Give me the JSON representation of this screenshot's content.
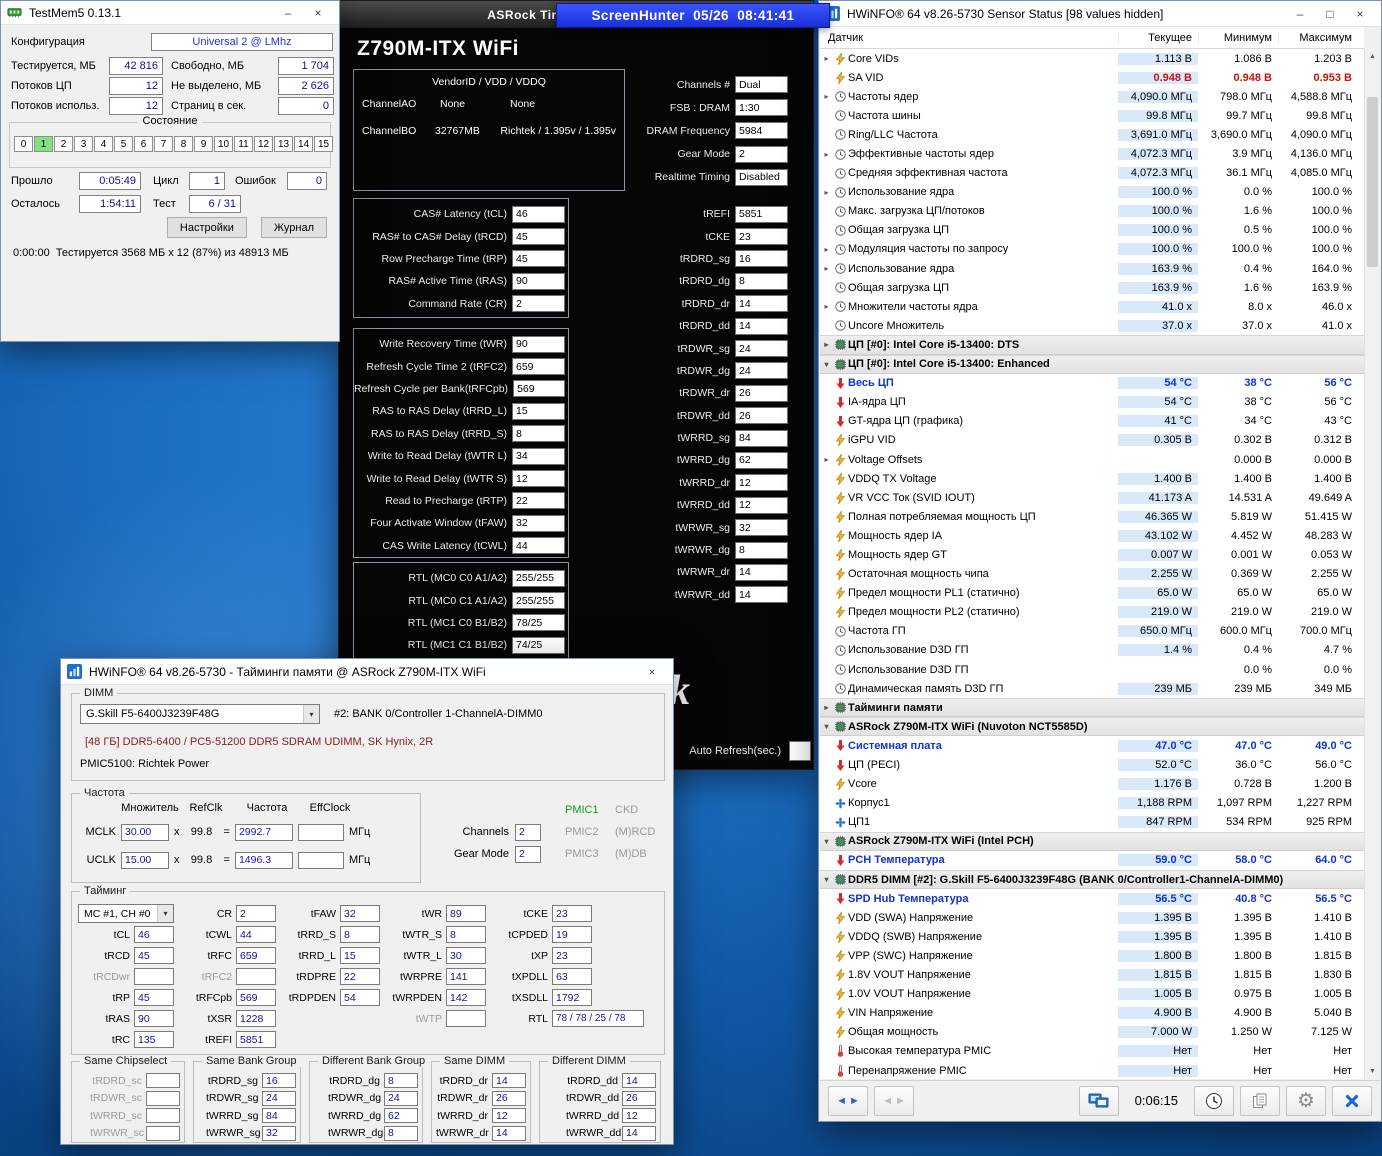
{
  "screenhunter": {
    "title": "ScreenHunter  05/26  08:41:41"
  },
  "testmem5": {
    "title": "TestMem5  0.13.1",
    "config_label": "Конфигурация",
    "config_value": "Universal 2 @ LMhz",
    "stats": [
      {
        "l1": "Тестируется, МБ",
        "v1": "42 816",
        "l2": "Свободно, МБ",
        "v2": "1 704"
      },
      {
        "l1": "Потоков ЦП",
        "v1": "12",
        "l2": "Не выделено, МБ",
        "v2": "2 626"
      },
      {
        "l1": "Потоков использ.",
        "v1": "12",
        "l2": "Страниц в сек.",
        "v2": "0"
      }
    ],
    "state_title": "Состояние",
    "cells": [
      "0",
      "1",
      "2",
      "3",
      "4",
      "5",
      "6",
      "7",
      "8",
      "9",
      "10",
      "11",
      "12",
      "13",
      "14",
      "15"
    ],
    "active_cell_index": 1,
    "progress": {
      "elapsed_label": "Прошло",
      "elapsed": "0:05:49",
      "cycle_label": "Цикл",
      "cycle": "1",
      "errors_label": "Ошибок",
      "errors": "0",
      "remaining_label": "Осталось",
      "remaining": "1:54:11",
      "test_label": "Тест",
      "test": "6 / 31"
    },
    "buttons": {
      "settings": "Настройки",
      "journal": "Журнал"
    },
    "log": "0:00:00  Тестируется 3568 МБ x 12 (87%) из 48913 МБ"
  },
  "asrock": {
    "window_title": "ASRock Timing Configurator",
    "board": "Z790M-ITX WiFi",
    "info": {
      "header": "VendorID / VDD / VDDQ",
      "rows": [
        {
          "channel": "ChannelAO",
          "c1": "None",
          "c2": "None"
        },
        {
          "channel": "ChannelBO",
          "c1": "32767MB",
          "c2": "Richtek / 1.395v / 1.395v"
        }
      ]
    },
    "config_fields": [
      {
        "label": "Channels #",
        "value": "Dual"
      },
      {
        "label": "FSB : DRAM",
        "value": "1:30"
      },
      {
        "label": "DRAM Frequency",
        "value": "5984"
      },
      {
        "label": "Gear Mode",
        "value": "2"
      },
      {
        "label": "Realtime Timing",
        "value": "Disabled"
      }
    ],
    "primary_timings": [
      {
        "label": "CAS# Latency (tCL)",
        "value": "46"
      },
      {
        "label": "RAS# to CAS# Delay (tRCD)",
        "value": "45"
      },
      {
        "label": "Row Precharge Time (tRP)",
        "value": "45"
      },
      {
        "label": "RAS# Active Time (tRAS)",
        "value": "90"
      },
      {
        "label": "Command Rate (CR)",
        "value": "2"
      }
    ],
    "secondary_timings": [
      {
        "label": "Write Recovery Time (tWR)",
        "value": "90"
      },
      {
        "label": "Refresh Cycle Time 2 (tRFC2)",
        "value": "659"
      },
      {
        "label": "Refresh Cycle per Bank(tRFCpb)",
        "value": "569"
      },
      {
        "label": "RAS to RAS Delay (tRRD_L)",
        "value": "15"
      },
      {
        "label": "RAS to RAS Delay (tRRD_S)",
        "value": "8"
      },
      {
        "label": "Write to Read Delay (tWTR  L)",
        "value": "34"
      },
      {
        "label": "Write to Read Delay (tWTR  S)",
        "value": "12"
      },
      {
        "label": "Read to Precharge (tRTP)",
        "value": "22"
      },
      {
        "label": "Four Activate Window (tFAW)",
        "value": "32"
      },
      {
        "label": "CAS Write Latency (tCWL)",
        "value": "44"
      }
    ],
    "rtl": [
      {
        "label": "RTL (MC0 C0 A1/A2)",
        "value": "255/255"
      },
      {
        "label": "RTL (MC0 C1 A1/A2)",
        "value": "255/255"
      },
      {
        "label": "RTL (MC1 C0 B1/B2)",
        "value": "78/25"
      },
      {
        "label": "RTL (MC1 C1 B1/B2)",
        "value": "74/25"
      }
    ],
    "right_timings": [
      {
        "label": "tREFI",
        "value": "5851"
      },
      {
        "label": "tCKE",
        "value": "23"
      },
      {
        "label": "tRDRD_sg",
        "value": "16"
      },
      {
        "label": "tRDRD_dg",
        "value": "8"
      },
      {
        "label": "tRDRD_dr",
        "value": "14"
      },
      {
        "label": "tRDRD_dd",
        "value": "14"
      },
      {
        "label": "tRDWR_sg",
        "value": "24"
      },
      {
        "label": "tRDWR_dg",
        "value": "24"
      },
      {
        "label": "tRDWR_dr",
        "value": "26"
      },
      {
        "label": "tRDWR_dd",
        "value": "26"
      },
      {
        "label": "tWRRD_sg",
        "value": "84"
      },
      {
        "label": "tWRRD_dg",
        "value": "62"
      },
      {
        "label": "tWRRD_dr",
        "value": "12"
      },
      {
        "label": "tWRRD_dd",
        "value": "12"
      },
      {
        "label": "tWRWR_sg",
        "value": "32"
      },
      {
        "label": "tWRWR_dg",
        "value": "8"
      },
      {
        "label": "tWRWR_dr",
        "value": "14"
      },
      {
        "label": "tWRWR_dd",
        "value": "14"
      }
    ],
    "logo": "ASRock",
    "refresh_label": "Auto Refresh(sec.)"
  },
  "hwinfo_timings": {
    "title": "HWiNFO® 64 v8.26-5730 - Тайминги памяти @ ASRock Z790M-ITX WiFi",
    "dimm": {
      "group_label": "DIMM",
      "dropdown": "G.Skill F5-6400J3239F48G",
      "slot": "#2: BANK 0/Controller 1-ChannelA-DIMM0",
      "module": "[48 ГБ] DDR5-6400 / PC5-51200 DDR5 SDRAM UDIMM, SK Hynix, 2R",
      "pmic": "PMIC5100: Richtek Power"
    },
    "freq": {
      "group_label": "Частота",
      "headers": [
        "Множитель",
        "RefClk",
        "Частота",
        "EffClock"
      ],
      "rows": [
        {
          "name": "MCLK",
          "mult": "30.00",
          "refclk": "99.8",
          "freq": "2992.7",
          "unit": "МГц"
        },
        {
          "name": "UCLK",
          "mult": "15.00",
          "refclk": "99.8",
          "freq": "1496.3",
          "unit": "МГц"
        }
      ],
      "channels_label": "Channels",
      "channels": "2",
      "gearmode_label": "Gear Mode",
      "gearmode": "2",
      "pmics": [
        {
          "name": "PMIC1",
          "value": "CKD"
        },
        {
          "name": "PMIC2",
          "value": "(M)RCD"
        },
        {
          "name": "PMIC3",
          "value": "(M)DB"
        }
      ]
    },
    "timing": {
      "group_label": "Тайминг",
      "mc_dropdown": "MC #1, CH #0",
      "grid": [
        [
          {
            "t": "dd"
          },
          {
            "l": "CR",
            "v": "2"
          },
          {
            "l": "tFAW",
            "v": "32"
          },
          {
            "l": "tWR",
            "v": "89"
          },
          {
            "l": "tCKE",
            "v": "23"
          }
        ],
        [
          {
            "l": "tCL",
            "v": "46"
          },
          {
            "l": "tCWL",
            "v": "44"
          },
          {
            "l": "tRRD_S",
            "v": "8"
          },
          {
            "l": "tWTR_S",
            "v": "8"
          },
          {
            "l": "tCPDED",
            "v": "19"
          }
        ],
        [
          {
            "l": "tRCD",
            "v": "45"
          },
          {
            "l": "tRFC",
            "v": "659"
          },
          {
            "l": "tRRD_L",
            "v": "15"
          },
          {
            "l": "tWTR_L",
            "v": "30"
          },
          {
            "l": "tXP",
            "v": "23"
          }
        ],
        [
          {
            "l": "tRCDwr",
            "v": "",
            "dim": true
          },
          {
            "l": "tRFC2",
            "v": "",
            "dim": true
          },
          {
            "l": "tRDPRE",
            "v": "22"
          },
          {
            "l": "tWRPRE",
            "v": "141"
          },
          {
            "l": "tXPDLL",
            "v": "63"
          }
        ],
        [
          {
            "l": "tRP",
            "v": "45"
          },
          {
            "l": "tRFCpb",
            "v": "569"
          },
          {
            "l": "tRDPDEN",
            "v": "54"
          },
          {
            "l": "tWRPDEN",
            "v": "142"
          },
          {
            "l": "tXSDLL",
            "v": "1792"
          }
        ],
        [
          {
            "l": "tRAS",
            "v": "90"
          },
          {
            "l": "tXSR",
            "v": "1228"
          },
          {},
          {
            "l": "tWTP",
            "v": "",
            "dim": true
          },
          {
            "l": "RTL",
            "v": "78 / 78 / 25 / 78",
            "wide": true
          }
        ],
        [
          {
            "l": "tRC",
            "v": "135"
          },
          {
            "l": "tREFI",
            "v": "5851"
          },
          {},
          {},
          {}
        ]
      ]
    },
    "banks": [
      {
        "title": "Same Chipselect",
        "rows": [
          {
            "l": "tRDRD_sc",
            "v": "",
            "dim": true
          },
          {
            "l": "tRDWR_sc",
            "v": "",
            "dim": true
          },
          {
            "l": "tWRRD_sc",
            "v": "",
            "dim": true
          },
          {
            "l": "tWRWR_sc",
            "v": "",
            "dim": true
          }
        ]
      },
      {
        "title": "Same Bank Group",
        "rows": [
          {
            "l": "tRDRD_sg",
            "v": "16"
          },
          {
            "l": "tRDWR_sg",
            "v": "24"
          },
          {
            "l": "tWRRD_sg",
            "v": "84"
          },
          {
            "l": "tWRWR_sg",
            "v": "32"
          }
        ]
      },
      {
        "title": "Different Bank Group",
        "rows": [
          {
            "l": "tRDRD_dg",
            "v": "8"
          },
          {
            "l": "tRDWR_dg",
            "v": "24"
          },
          {
            "l": "tWRRD_dg",
            "v": "62"
          },
          {
            "l": "tWRWR_dg",
            "v": "8"
          }
        ]
      },
      {
        "title": "Same DIMM",
        "rows": [
          {
            "l": "tRDRD_dr",
            "v": "14"
          },
          {
            "l": "tRDWR_dr",
            "v": "26"
          },
          {
            "l": "tWRRD_dr",
            "v": "12"
          },
          {
            "l": "tWRWR_dr",
            "v": "14"
          }
        ]
      },
      {
        "title": "Different DIMM",
        "rows": [
          {
            "l": "tRDRD_dd",
            "v": "14"
          },
          {
            "l": "tRDWR_dd",
            "v": "26"
          },
          {
            "l": "tWRRD_dd",
            "v": "12"
          },
          {
            "l": "tWRWR_dd",
            "v": "14"
          }
        ]
      }
    ]
  },
  "hwinfo_sensors": {
    "title": "HWiNFO® 64 v8.26-5730 Sensor Status [98 values hidden]",
    "columns": [
      "Датчик",
      "Текущее",
      "Минимум",
      "Максимум"
    ],
    "rows": [
      {
        "i": "bolt",
        "e": true,
        "n": "Core VIDs",
        "c": "1.113 В",
        "m": "1.086 В",
        "x": "1.203 В"
      },
      {
        "i": "bolt",
        "r": true,
        "n": "SA VID",
        "c": "0.948 В",
        "m": "0.948 В",
        "x": "0.953 В"
      },
      {
        "i": "clock",
        "e": true,
        "n": "Частоты ядер",
        "c": "4,090.0 МГц",
        "m": "798.0 МГц",
        "x": "4,588.8 МГц"
      },
      {
        "i": "clock",
        "n": "Частота шины",
        "c": "99.8 МГц",
        "m": "99.7 МГц",
        "x": "99.8 МГц"
      },
      {
        "i": "clock",
        "n": "Ring/LLC Частота",
        "c": "3,691.0 МГц",
        "m": "3,690.0 МГц",
        "x": "4,090.0 МГц"
      },
      {
        "i": "clock",
        "e": true,
        "n": "Эффективные частоты ядер",
        "c": "4,072.3 МГц",
        "m": "3.9 МГц",
        "x": "4,136.0 МГц"
      },
      {
        "i": "clock",
        "n": "Средняя эффективная частота",
        "c": "4,072.3 МГц",
        "m": "36.1 МГц",
        "x": "4,085.0 МГц"
      },
      {
        "i": "clock",
        "e": true,
        "n": "Использование ядра",
        "c": "100.0 %",
        "m": "0.0 %",
        "x": "100.0 %"
      },
      {
        "i": "clock",
        "n": "Макс. загрузка ЦП/потоков",
        "c": "100.0 %",
        "m": "1.6 %",
        "x": "100.0 %"
      },
      {
        "i": "clock",
        "n": "Общая загрузка ЦП",
        "c": "100.0 %",
        "m": "0.5 %",
        "x": "100.0 %"
      },
      {
        "i": "clock",
        "e": true,
        "n": "Модуляция частоты по запросу",
        "c": "100.0 %",
        "m": "100.0 %",
        "x": "100.0 %"
      },
      {
        "i": "clock",
        "e": true,
        "n": "Использование ядра",
        "c": "163.9 %",
        "m": "0.4 %",
        "x": "164.0 %"
      },
      {
        "i": "clock",
        "n": "Общая загрузка ЦП",
        "c": "163.9 %",
        "m": "1.6 %",
        "x": "163.9 %"
      },
      {
        "i": "clock",
        "e": true,
        "n": "Множители частоты ядра",
        "c": "41.0 x",
        "m": "8.0 x",
        "x": "46.0 x"
      },
      {
        "i": "clock",
        "n": "Uncore Множитель",
        "c": "37.0 x",
        "m": "37.0 x",
        "x": "41.0 x"
      },
      {
        "t": "s",
        "n": "ЦП [#0]: Intel Core i5-13400: DTS"
      },
      {
        "t": "s",
        "o": true,
        "n": "ЦП [#0]: Intel Core i5-13400: Enhanced"
      },
      {
        "i": "arrow",
        "a": true,
        "n": "Весь ЦП",
        "c": "54 °C",
        "m": "38 °C",
        "x": "56 °C"
      },
      {
        "i": "arrow",
        "n": "IA-ядра ЦП",
        "c": "54 °C",
        "m": "38 °C",
        "x": "56 °C"
      },
      {
        "i": "arrow",
        "n": "GT-ядра ЦП (графика)",
        "c": "41 °C",
        "m": "34 °C",
        "x": "43 °C"
      },
      {
        "i": "bolt",
        "n": "iGPU VID",
        "c": "0.305 В",
        "m": "0.302 В",
        "x": "0.312 В"
      },
      {
        "i": "bolt",
        "e": true,
        "n": "Voltage Offsets",
        "c": "",
        "m": "0.000 В",
        "x": "0.000 В"
      },
      {
        "i": "bolt",
        "n": "VDDQ TX Voltage",
        "c": "1.400 В",
        "m": "1.400 В",
        "x": "1.400 В"
      },
      {
        "i": "bolt",
        "n": "VR VCC Ток (SVID IOUT)",
        "c": "41.173 A",
        "m": "14.531 A",
        "x": "49.649 A"
      },
      {
        "i": "bolt",
        "n": "Полная потребляемая мощность ЦП",
        "c": "46.365 W",
        "m": "5.819 W",
        "x": "51.415 W"
      },
      {
        "i": "bolt",
        "n": "Мощность ядер IA",
        "c": "43.102 W",
        "m": "4.452 W",
        "x": "48.283 W"
      },
      {
        "i": "bolt",
        "n": "Мощность ядер GT",
        "c": "0.007 W",
        "m": "0.001 W",
        "x": "0.053 W"
      },
      {
        "i": "bolt",
        "n": "Остаточная мощность чипа",
        "c": "2.255 W",
        "m": "0.369 W",
        "x": "2.255 W"
      },
      {
        "i": "bolt",
        "n": "Предел мощности PL1 (статично)",
        "c": "65.0 W",
        "m": "65.0 W",
        "x": "65.0 W"
      },
      {
        "i": "bolt",
        "n": "Предел мощности PL2 (статично)",
        "c": "219.0 W",
        "m": "219.0 W",
        "x": "219.0 W"
      },
      {
        "i": "clock",
        "n": "Частота ГП",
        "c": "650.0 МГц",
        "m": "600.0 МГц",
        "x": "700.0 МГц"
      },
      {
        "i": "clock",
        "n": "Использование D3D ГП",
        "c": "1.4 %",
        "m": "0.4 %",
        "x": "4.7 %"
      },
      {
        "i": "clock",
        "n": "Использование D3D ГП",
        "c": "",
        "m": "0.0 %",
        "x": "0.0 %"
      },
      {
        "i": "clock",
        "n": "Динамическая память D3D ГП",
        "c": "239 МБ",
        "m": "239 МБ",
        "x": "349 МБ"
      },
      {
        "t": "s",
        "n": "Тайминги памяти"
      },
      {
        "t": "s",
        "o": true,
        "n": "ASRock Z790M-ITX WiFi (Nuvoton NCT5585D)"
      },
      {
        "i": "arrow",
        "a": true,
        "n": "Системная плата",
        "c": "47.0 °C",
        "m": "47.0 °C",
        "x": "49.0 °C"
      },
      {
        "i": "arrow",
        "n": "ЦП (PECI)",
        "c": "52.0 °C",
        "m": "36.0 °C",
        "x": "56.0 °C"
      },
      {
        "i": "bolt",
        "n": "Vcore",
        "c": "1.176 В",
        "m": "0.728 В",
        "x": "1.200 В"
      },
      {
        "i": "fan",
        "n": "Корпус1",
        "c": "1,188 RPM",
        "m": "1,097 RPM",
        "x": "1,227 RPM"
      },
      {
        "i": "fan",
        "n": "ЦП1",
        "c": "847 RPM",
        "m": "534 RPM",
        "x": "925 RPM"
      },
      {
        "t": "s",
        "o": true,
        "n": "ASRock Z790M-ITX WiFi (Intel PCH)"
      },
      {
        "i": "arrow",
        "a": true,
        "n": "PCH Температура",
        "c": "59.0 °C",
        "m": "58.0 °C",
        "x": "64.0 °C"
      },
      {
        "t": "s",
        "o": true,
        "n": "DDR5 DIMM [#2]: G.Skill F5-6400J3239F48G (BANK 0/Controller1-ChannelA-DIMM0)"
      },
      {
        "i": "arrow",
        "a": true,
        "n": "SPD Hub Температура",
        "c": "56.5 °C",
        "m": "40.8 °C",
        "x": "56.5 °C"
      },
      {
        "i": "bolt",
        "n": "VDD (SWA) Напряжение",
        "c": "1.395 В",
        "m": "1.395 В",
        "x": "1.410 В"
      },
      {
        "i": "bolt",
        "n": "VDDQ (SWB) Напряжение",
        "c": "1.395 В",
        "m": "1.395 В",
        "x": "1.410 В"
      },
      {
        "i": "bolt",
        "n": "VPP (SWC) Напряжение",
        "c": "1.800 В",
        "m": "1.800 В",
        "x": "1.815 В"
      },
      {
        "i": "bolt",
        "n": "1.8V VOUT Напряжение",
        "c": "1.815 В",
        "m": "1.815 В",
        "x": "1.830 В"
      },
      {
        "i": "bolt",
        "n": "1.0V VOUT Напряжение",
        "c": "1.005 В",
        "m": "0.975 В",
        "x": "1.005 В"
      },
      {
        "i": "bolt",
        "n": "VIN Напряжение",
        "c": "4.900 В",
        "m": "4.900 В",
        "x": "5.040 В"
      },
      {
        "i": "bolt",
        "n": "Общая мощность",
        "c": "7.000 W",
        "m": "1.250 W",
        "x": "7.125 W"
      },
      {
        "i": "therm",
        "n": "Высокая температура PMIC",
        "c": "Нет",
        "m": "Нет",
        "x": "Нет"
      },
      {
        "i": "therm",
        "n": "Перенапряжение PMIC",
        "c": "Нет",
        "m": "Нет",
        "x": "Нет"
      }
    ],
    "statusbar": {
      "time": "0:06:15"
    }
  }
}
